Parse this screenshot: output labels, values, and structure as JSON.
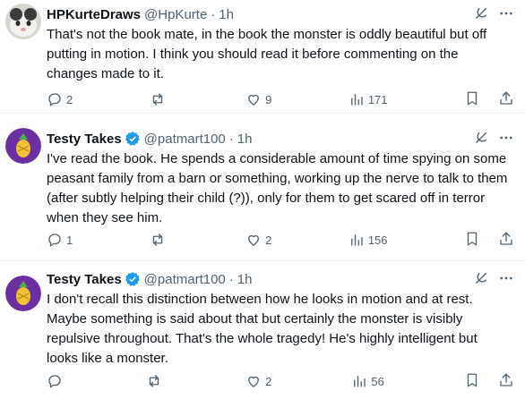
{
  "tweets": [
    {
      "name": "HPKurteDraws",
      "handle": "@HpKurte",
      "separator": "·",
      "time": "1h",
      "verified": false,
      "text": "That's not the book mate, in the book the monster is oddly beautiful but off putting in motion. I think you should read it before commenting on the changes made to it.",
      "replies": "2",
      "reposts": "",
      "likes": "9",
      "views": "171"
    },
    {
      "name": "Testy Takes",
      "handle": "@patmart100",
      "separator": "·",
      "time": "1h",
      "verified": true,
      "text": "I've read the book. He spends a considerable amount of time spying on some peasant family from a barn or something, working up the nerve to talk to them (after subtly helping their child (?)), only for them to get scared off in terror when they see him.",
      "replies": "1",
      "reposts": "",
      "likes": "2",
      "views": "156"
    },
    {
      "name": "Testy Takes",
      "handle": "@patmart100",
      "separator": "·",
      "time": "1h",
      "verified": true,
      "text": "I don't recall this distinction between how he looks in motion and at rest. Maybe something is said about that but certainly the monster is visibly repulsive throughout. That's the whole tragedy! He's highly intelligent but looks like a monster.",
      "replies": "",
      "reposts": "",
      "likes": "2",
      "views": "56"
    }
  ],
  "colors": {
    "text": "#0f1419",
    "muted": "#536471",
    "verified": "#1d9bf0",
    "divider": "#eff3f4",
    "avatar_purple": "#6b2fa0",
    "avatar_gold": "#f2c232"
  },
  "icons": [
    "reply-icon",
    "repost-icon",
    "like-icon",
    "views-icon",
    "bookmark-icon",
    "share-icon",
    "grok-icon",
    "more-icon",
    "verified-icon"
  ]
}
